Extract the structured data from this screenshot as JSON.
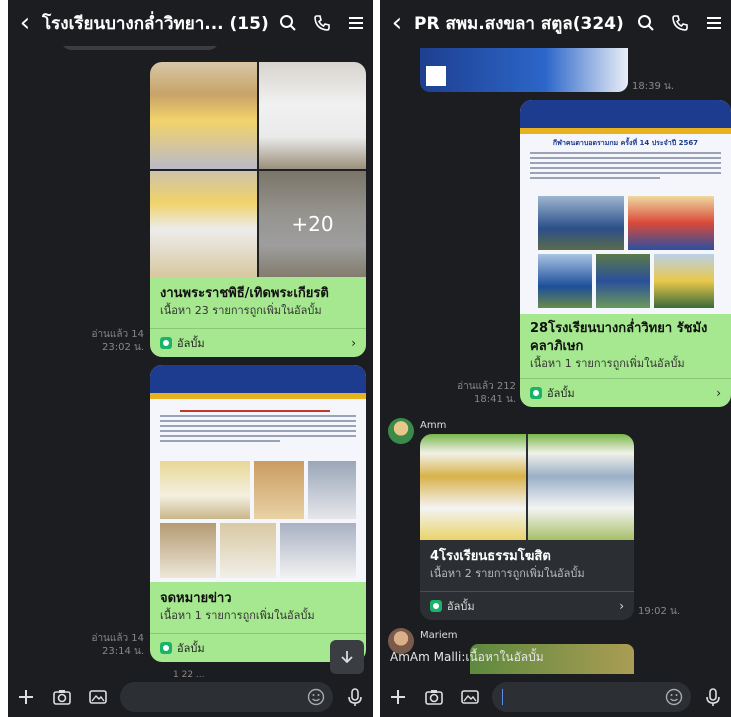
{
  "left": {
    "title": "โรงเรียนบางกล่ำวิทยา... (15)",
    "cards": [
      {
        "title": "งานพระราชพิธี/เทิดพระเกียรติ",
        "subtitle": "เนื้อหา 23 รายการถูกเพิ่มในอัลบั้ม",
        "footer": "อัลบั้ม",
        "more_count": "+20"
      },
      {
        "title": "จดหมายข่าว",
        "subtitle": "เนื้อหา 1 รายการถูกเพิ่มในอัลบั้ม",
        "footer": "อัลบั้ม"
      }
    ],
    "meta1": {
      "read": "อ่านแล้ว 14",
      "time": "23:02 น."
    },
    "meta2": {
      "read": "อ่านแล้ว 14",
      "time": "23:14 น."
    },
    "partial_time": "1 22 ..."
  },
  "right": {
    "title": "PR สพม.สงขลา สตูล(324)",
    "top_time": "18:39 น.",
    "cards": [
      {
        "title": "28โรงเรียนบางกล่ำวิทยา รัชมังคลาภิเษก",
        "subtitle": "เนื้อหา 1 รายการถูกเพิ่มในอัลบั้ม",
        "footer": "อัลบั้ม",
        "doc_heading": "กีฬาคนตาบอดรามกม ครั้งที่ 14 ประจำปี 2567"
      },
      {
        "title": "4โรงเรียนธรรมโฆสิต",
        "subtitle": "เนื้อหา 2 รายการถูกเพิ่มในอัลบั้ม",
        "footer": "อัลบั้ม"
      }
    ],
    "meta1": {
      "read": "อ่านแล้ว 212",
      "time": "18:41 น."
    },
    "sender1": "Amm",
    "time2": "19:02 น.",
    "sender2": "Mariem",
    "notification": "AmAm Malli:เนื้อหาในอัลบั้ม"
  },
  "colors": {
    "bg": "#1b1d21",
    "card_green": "#a6e88f",
    "album_icon": "#19b36a"
  }
}
